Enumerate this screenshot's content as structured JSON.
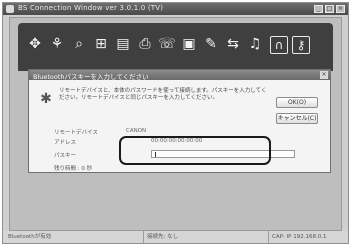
{
  "window": {
    "title": "BS Connection Window ver 3.0.1.0 (TV)",
    "controls": [
      "_",
      "□",
      "×"
    ]
  },
  "toolbar": {
    "icons": [
      "network-icon",
      "devices-icon",
      "search-icon",
      "computer-icon",
      "document-icon",
      "printer-icon",
      "fax-icon",
      "folder-icon",
      "pen-icon",
      "transfer-icon",
      "audio-icon",
      "headset-icon",
      "key-icon"
    ]
  },
  "dialog": {
    "title": "Bluetoothパスキーを入力してください",
    "message": "リモートデバイスと、本体のパスワードを使って接続します。パスキーを入力してください。リモートデバイスと同じパスキーを入力してください。",
    "ok_label": "OK(O)",
    "cancel_label": "キャンセル(C)",
    "fields": {
      "remote_device_label": "リモートデバイス",
      "remote_device_value": "CANON",
      "address_label": "アドレス",
      "address_value": "00:00:00:00:00:00",
      "passkey_label": "パスキー",
      "passkey_value": ""
    },
    "timeout_label": "残り時間 : 0 秒"
  },
  "status": {
    "left": "Bluetoothが有効",
    "middle": "接続先: なし",
    "right": "CAP: IP 192.168.0.1"
  }
}
